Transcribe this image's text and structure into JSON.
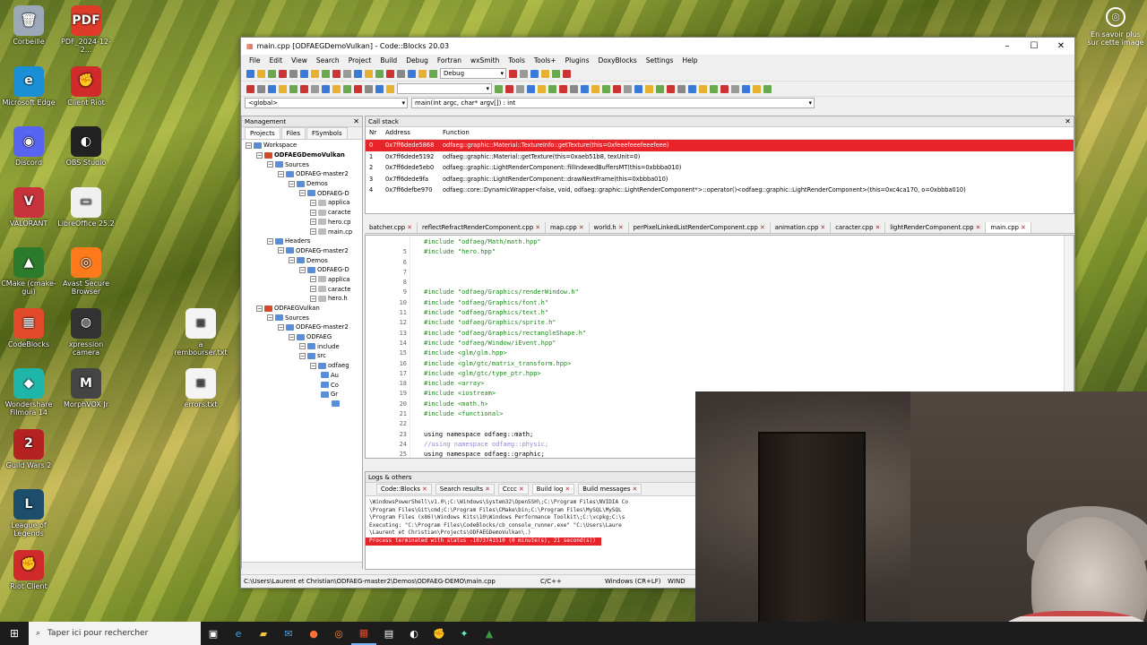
{
  "desktop": {
    "icons": [
      {
        "label": "Corbeille",
        "glyph": "🗑",
        "color": "#9aa8b8"
      },
      {
        "label": "Microsoft Edge",
        "glyph": "e",
        "color": "#1a8fd6"
      },
      {
        "label": "Discord",
        "glyph": "◉",
        "color": "#5865f2"
      },
      {
        "label": "VALORANT",
        "glyph": "V",
        "color": "#c8323a"
      },
      {
        "label": "CMake (cmake-gui)",
        "glyph": "▲",
        "color": "#2c7a2c"
      },
      {
        "label": "CodeBlocks",
        "glyph": "▦",
        "color": "#e04a2a"
      },
      {
        "label": "Wondershare Filmora 14",
        "glyph": "◆",
        "color": "#1fb5a8"
      },
      {
        "label": "Guild Wars 2",
        "glyph": "2",
        "color": "#b42222"
      },
      {
        "label": "League of Legends",
        "glyph": "L",
        "color": "#1c4d6b"
      },
      {
        "label": "Riot Client",
        "glyph": "✊",
        "color": "#d12a2a"
      }
    ],
    "icons_col2": [
      {
        "label": "PDF_2024-12-2...",
        "glyph": "PDF",
        "color": "#e03a2a"
      },
      {
        "label": "Client Riot",
        "glyph": "✊",
        "color": "#d12a2a"
      },
      {
        "label": "OBS Studio",
        "glyph": "◐",
        "color": "#222"
      },
      {
        "label": "LibreOffice 25.2",
        "glyph": "▭",
        "color": "#f0f0f0"
      },
      {
        "label": "Avast Secure Browser",
        "glyph": "◎",
        "color": "#ff7a1a"
      },
      {
        "label": "xpression camera",
        "glyph": "◍",
        "color": "#333"
      },
      {
        "label": "MorphVOX Jr",
        "glyph": "M",
        "color": "#444"
      }
    ],
    "icons_col3": [
      {
        "label": "a rembourser.txt",
        "glyph": "≡",
        "color": "#f4f4f4"
      },
      {
        "label": "errors.txt",
        "glyph": "≡",
        "color": "#f4f4f4"
      }
    ],
    "notice": "En savoir plus sur cette image"
  },
  "window": {
    "title": "main.cpp [ODFAEGDemoVulkan] - Code::Blocks 20.03",
    "menu": [
      "File",
      "Edit",
      "View",
      "Search",
      "Project",
      "Build",
      "Debug",
      "Fortran",
      "wxSmith",
      "Tools",
      "Tools+",
      "Plugins",
      "DoxyBlocks",
      "Settings",
      "Help"
    ],
    "build_target": "Debug",
    "scope": "<global>",
    "function_scope": "main(int argc, char* argv[]) : int"
  },
  "management": {
    "title": "Management",
    "tabs": [
      "Projects",
      "Files",
      "FSymbols"
    ],
    "tree": [
      {
        "d": 0,
        "t": "Workspace",
        "c": "#5b8bd6"
      },
      {
        "d": 1,
        "t": "ODFAEGDemoVulkan",
        "c": "#d24a2a",
        "bold": true
      },
      {
        "d": 2,
        "t": "Sources",
        "c": "#5a8fd8"
      },
      {
        "d": 3,
        "t": "ODFAEG-master2",
        "c": "#5a8fd8"
      },
      {
        "d": 4,
        "t": "Demos",
        "c": "#5a8fd8"
      },
      {
        "d": 5,
        "t": "ODFAEG-D",
        "c": "#5a8fd8"
      },
      {
        "d": 6,
        "t": "applica",
        "c": "#bbb"
      },
      {
        "d": 6,
        "t": "caracte",
        "c": "#bbb"
      },
      {
        "d": 6,
        "t": "hero.cp",
        "c": "#bbb"
      },
      {
        "d": 6,
        "t": "main.cp",
        "c": "#bbb"
      },
      {
        "d": 2,
        "t": "Headers",
        "c": "#5a8fd8"
      },
      {
        "d": 3,
        "t": "ODFAEG-master2",
        "c": "#5a8fd8"
      },
      {
        "d": 4,
        "t": "Demos",
        "c": "#5a8fd8"
      },
      {
        "d": 5,
        "t": "ODFAEG-D",
        "c": "#5a8fd8"
      },
      {
        "d": 6,
        "t": "applica",
        "c": "#bbb"
      },
      {
        "d": 6,
        "t": "caracte",
        "c": "#bbb"
      },
      {
        "d": 6,
        "t": "hero.h",
        "c": "#bbb"
      },
      {
        "d": 1,
        "t": "ODFAEGVulkan",
        "c": "#d24a2a"
      },
      {
        "d": 2,
        "t": "Sources",
        "c": "#5a8fd8"
      },
      {
        "d": 3,
        "t": "ODFAEG-master2",
        "c": "#5a8fd8"
      },
      {
        "d": 4,
        "t": "ODFAEG",
        "c": "#5a8fd8"
      },
      {
        "d": 5,
        "t": "include",
        "c": "#5a8fd8"
      },
      {
        "d": 5,
        "t": "src",
        "c": "#5a8fd8"
      },
      {
        "d": 6,
        "t": "odfaeg",
        "c": "#5a8fd8"
      },
      {
        "d": 7,
        "t": "Au",
        "c": "#5a8fd8"
      },
      {
        "d": 7,
        "t": "Co",
        "c": "#5a8fd8"
      },
      {
        "d": 7,
        "t": "Gr",
        "c": "#5a8fd8"
      },
      {
        "d": 8,
        "t": "",
        "c": "#5a8fd8"
      }
    ]
  },
  "callstack": {
    "title": "Call stack",
    "cols": [
      "Nr",
      "Address",
      "Function"
    ],
    "rows": [
      {
        "nr": "0",
        "addr": "0x7ff6dede5868",
        "fn": "odfaeg::graphic::Material::TextureInfo::getTexture(this=0xfeeefeeefeeefeee)"
      },
      {
        "nr": "1",
        "addr": "0x7ff6dede5192",
        "fn": "odfaeg::graphic::Material::getTexture(this=0xaeb51b8, texUnit=0)"
      },
      {
        "nr": "2",
        "addr": "0x7ff6dede5eb0",
        "fn": "odfaeg::graphic::LightRenderComponent::fillIndexedBuffersMT(this=0xbbba010)"
      },
      {
        "nr": "3",
        "addr": "0x7ff6dede9fa",
        "fn": "odfaeg::graphic::LightRenderComponent::drawNextFrame(this=0xbbba010)"
      },
      {
        "nr": "4",
        "addr": "0x7ff6defbe970",
        "fn": "odfaeg::core::DynamicWrapper<false, void, odfaeg::graphic::LightRenderComponent*>::operator()<odfaeg::graphic::LightRenderComponent>(this=0xc4ca170, o=0xbbba010)"
      }
    ]
  },
  "editor": {
    "tabs": [
      "batcher.cpp",
      "reflectRefractRenderComponent.cpp",
      "map.cpp",
      "world.h",
      "perPixelLinkedListRenderComponent.cpp",
      "animation.cpp",
      "caracter.cpp",
      "lightRenderComponent.cpp",
      "main.cpp"
    ],
    "lines": [
      {
        "n": "",
        "t": "#include \"odfaeg/Math/math.hpp\"",
        "k": ""
      },
      {
        "n": "5",
        "t": "#include \"hero.hpp\"",
        "k": ""
      },
      {
        "n": "6",
        "t": "",
        "k": ""
      },
      {
        "n": "7",
        "t": "",
        "k": ""
      },
      {
        "n": "8",
        "t": "",
        "k": ""
      },
      {
        "n": "9",
        "t": "#include \"odfaeg/Graphics/renderWindow.h\"",
        "k": ""
      },
      {
        "n": "10",
        "t": "#include \"odfaeg/Graphics/font.h\"",
        "k": ""
      },
      {
        "n": "11",
        "t": "#include \"odfaeg/Graphics/text.h\"",
        "k": ""
      },
      {
        "n": "12",
        "t": "#include \"odfaeg/Graphics/sprite.h\"",
        "k": ""
      },
      {
        "n": "13",
        "t": "#include \"odfaeg/Graphics/rectangleShape.h\"",
        "k": ""
      },
      {
        "n": "14",
        "t": "#include \"odfaeg/Window/iEvent.hpp\"",
        "k": ""
      },
      {
        "n": "15",
        "t": "#include <glm/glm.hpp>",
        "k": ""
      },
      {
        "n": "16",
        "t": "#include <glm/gtc/matrix_transform.hpp>",
        "k": ""
      },
      {
        "n": "17",
        "t": "#include <glm/gtc/type_ptr.hpp>",
        "k": ""
      },
      {
        "n": "18",
        "t": "#include <array>",
        "k": ""
      },
      {
        "n": "19",
        "t": "#include <iostream>",
        "k": ""
      },
      {
        "n": "20",
        "t": "#include <math.h>",
        "k": ""
      },
      {
        "n": "21",
        "t": "#include <functional>",
        "k": ""
      },
      {
        "n": "22",
        "t": "",
        "k": ""
      },
      {
        "n": "23",
        "t": "using namespace odfaeg::math;",
        "k": "kw"
      },
      {
        "n": "24",
        "t": "//using namespace odfaeg::physic;",
        "k": "cm"
      },
      {
        "n": "25",
        "t": "using namespace odfaeg::graphic;",
        "k": "kw"
      }
    ]
  },
  "logs": {
    "title": "Logs & others",
    "tabs": [
      "Code::Blocks",
      "Search results",
      "Cccc",
      "Build log",
      "Build messages"
    ],
    "lines": [
      "\\WindowsPowerShell\\v1.0\\;C:\\Windows\\System32\\OpenSSH\\;C:\\Program Files\\NVIDIA Co",
      "\\Program Files\\Git\\cmd;C:\\Program Files\\CMake\\bin;C:\\Program Files\\MySQL\\MySQL",
      "\\Program Files (x86)\\Windows Kits\\10\\Windows Performance Toolkit\\;C:\\vcpkg;C:\\s",
      "Executing: \"C:\\Program Files\\CodeBlocks/cb_console_runner.exe\" \"C:\\Users\\Laure",
      "\\Laurent et Christian\\Projects\\ODFAEGDemoVulkan\\.)"
    ],
    "error_line": "Process terminated with status -1073741510 (0 minute(s), 21 second(s))"
  },
  "status": {
    "path": "C:\\Users\\Laurent et Christian\\ODFAEG-master2\\Demos\\ODFAEG-DEMO\\main.cpp",
    "lang": "C/C++",
    "eol": "Windows (CR+LF)",
    "enc": "WIND"
  },
  "taskbar": {
    "search_placeholder": "Taper ici pour rechercher"
  }
}
